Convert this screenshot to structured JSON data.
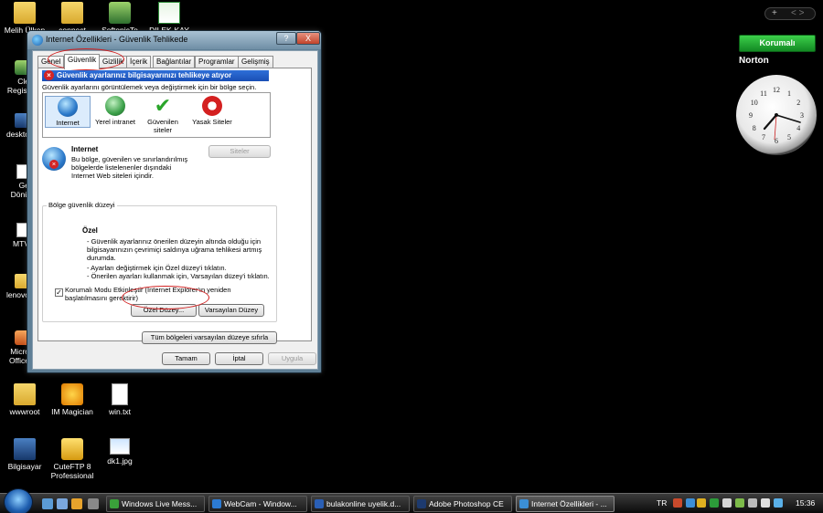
{
  "desktop": {
    "icons_top": [
      {
        "label": "Melih Ülken"
      },
      {
        "label": "connect"
      },
      {
        "label": "SoftonicTo"
      },
      {
        "label": "DILEK-KAY"
      }
    ],
    "left_column": [
      {
        "label": "Cle\nRegist"
      },
      {
        "label": "deskto"
      },
      {
        "label": "Ge\nDönü"
      },
      {
        "label": "MTV"
      },
      {
        "label": "lenovo"
      },
      {
        "label": "Micro\nOffice"
      }
    ],
    "icons_bottom": [
      {
        "label": "wwwroot"
      },
      {
        "label": "IM Magician"
      },
      {
        "label": "win.txt"
      },
      {
        "label": "Bilgisayar"
      },
      {
        "label": "CuteFTP 8 Professional"
      },
      {
        "label": "dk1.jpg"
      }
    ]
  },
  "dialog": {
    "title": "Internet Özellikleri - Güvenlik Tehlikede",
    "help_label": "?",
    "close_label": "X",
    "tabs": [
      "Genel",
      "Güvenlik",
      "Gizlilik",
      "İçerik",
      "Bağlantılar",
      "Programlar",
      "Gelişmiş"
    ],
    "active_tab": "Güvenlik",
    "banner": "Güvenlik ayarlarınız bilgisayarınızı tehlikeye atıyor",
    "zones_prompt": "Güvenlik ayarlarını görüntülemek veya değiştirmek için bir bölge seçin.",
    "zones": [
      "Internet",
      "Yerel intranet",
      "Güvenilen siteler",
      "Yasak Siteler"
    ],
    "selected_zone": {
      "name": "Internet",
      "description": "Bu bölge, güvenilen ve sınırlandırılmış bölgelerde listelenenler dışındaki Internet Web siteleri içindir."
    },
    "sites_button": "Siteler",
    "security_level": {
      "legend": "Bölge güvenlik düzeyi",
      "heading": "Özel",
      "lines": [
        "- Güvenlik ayarlarınız önerilen düzeyin altında olduğu için bilgisayarınızın çevrimiçi saldırıya uğrama tehlikesi artmış durumda.",
        "- Ayarları değiştirmek için Özel düzey'i tıklatın.",
        "- Önerilen ayarları kullanmak için, Varsayılan düzey'i tıklatın."
      ]
    },
    "protected_mode": {
      "label": "Korumalı Modu Etkinleştir (Internet Explorer'ın yeniden başlatılmasını gerektirir)",
      "checked": true
    },
    "custom_level_button": "Özel Düzey...",
    "default_level_button": "Varsayılan Düzey",
    "reset_all_button": "Tüm bölgeleri varsayılan düzeye sıfırla",
    "ok_button": "Tamam",
    "cancel_button": "İptal",
    "apply_button": "Uygula"
  },
  "gadgets": {
    "sidebar_add": "+",
    "sidebar_nav": "< >",
    "norton_button": "Korumalı",
    "norton_logo": "Norton",
    "clock_numbers": [
      "12",
      "1",
      "2",
      "3",
      "4",
      "5",
      "6",
      "7",
      "8",
      "9",
      "10",
      "11"
    ]
  },
  "taskbar": {
    "tasks": [
      {
        "label": "Windows Live Mess...",
        "color": "#3aa03a"
      },
      {
        "label": "WebCam - Window...",
        "color": "#2c7bd3"
      },
      {
        "label": "bulakonline uyelik.d...",
        "color": "#2a5fb5"
      },
      {
        "label": "Adobe Photoshop CE",
        "color": "#1d3a6e"
      },
      {
        "label": "Internet Özellikleri - ...",
        "color": "#3b8fd6"
      }
    ],
    "language": "TR",
    "time": "15:36"
  }
}
